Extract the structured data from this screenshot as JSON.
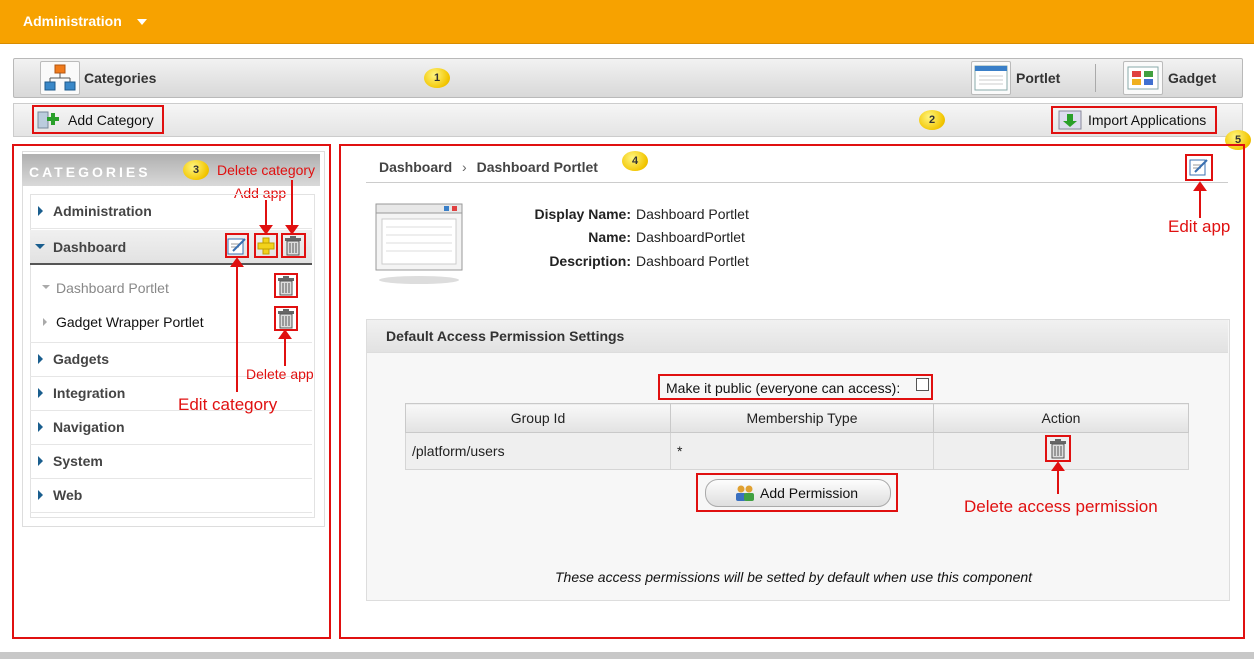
{
  "topbar": {
    "title": "Administration"
  },
  "tabs": {
    "categories": "Categories",
    "portlet": "Portlet",
    "gadget": "Gadget"
  },
  "actions": {
    "add_category": "Add Category",
    "import_applications": "Import Applications"
  },
  "badges": [
    "1",
    "2",
    "3",
    "4",
    "5"
  ],
  "sidebar": {
    "title": "CATEGORIES",
    "categories": [
      {
        "label": "Administration",
        "expanded": false
      },
      {
        "label": "Dashboard",
        "expanded": true,
        "apps": [
          "Dashboard Portlet",
          "Gadget Wrapper Portlet"
        ]
      },
      {
        "label": "Gadgets",
        "expanded": false
      },
      {
        "label": "Integration",
        "expanded": false
      },
      {
        "label": "Navigation",
        "expanded": false
      },
      {
        "label": "System",
        "expanded": false
      },
      {
        "label": "Web",
        "expanded": false
      }
    ]
  },
  "breadcrumb": {
    "parent": "Dashboard",
    "sep": "›",
    "current": "Dashboard Portlet"
  },
  "app_info": {
    "display_name_label": "Display Name:",
    "display_name": "Dashboard Portlet",
    "name_label": "Name:",
    "name": "DashboardPortlet",
    "description_label": "Description:",
    "description": "Dashboard Portlet"
  },
  "permissions": {
    "title": "Default Access Permission Settings",
    "public_label": "Make it public (everyone can access):",
    "public_checked": false,
    "columns": [
      "Group Id",
      "Membership Type",
      "Action"
    ],
    "rows": [
      {
        "group": "/platform/users",
        "membership": "*"
      }
    ],
    "add_button": "Add Permission",
    "footer_note": "These access permissions will be setted by default when use this component"
  },
  "annotations": {
    "delete_category": "Delete category",
    "add_app": "Add app",
    "edit_category": "Edit category",
    "delete_app": "Delete app",
    "edit_app": "Edit app",
    "delete_access_permission": "Delete access permission"
  },
  "colors": {
    "accent": "#f7a200",
    "annotation": "#e01010"
  }
}
